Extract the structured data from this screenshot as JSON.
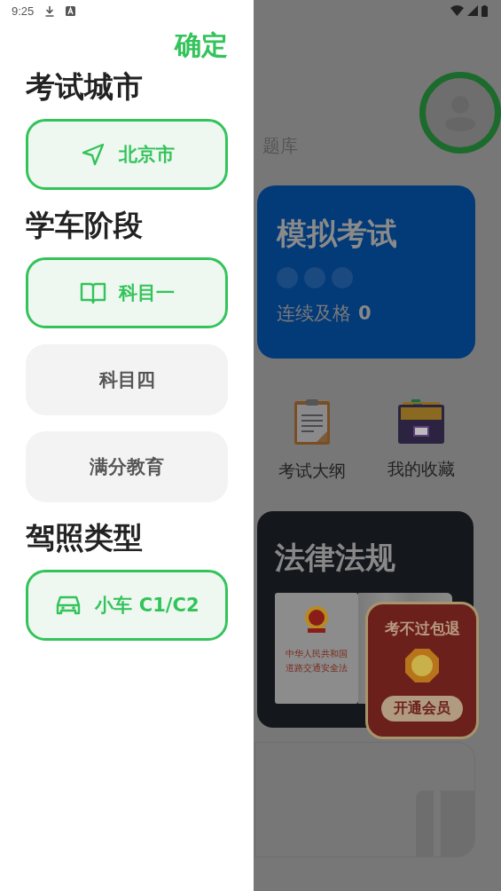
{
  "status_bar": {
    "time": "9:25"
  },
  "drawer": {
    "confirm": "确定",
    "sections": [
      {
        "title": "考试城市",
        "options": [
          {
            "label": "北京市",
            "selected": true
          }
        ]
      },
      {
        "title": "学车阶段",
        "options": [
          {
            "label": "科目一",
            "selected": true
          },
          {
            "label": "科目四",
            "selected": false
          },
          {
            "label": "满分教育",
            "selected": false
          }
        ]
      },
      {
        "title": "驾照类型",
        "options": [
          {
            "label": "小车 C1/C2",
            "selected": true
          }
        ]
      }
    ]
  },
  "background": {
    "bank_label": "题库",
    "mock_exam": {
      "title": "模拟考试",
      "streak_label": "连续及格",
      "streak_count": "0"
    },
    "shortcuts": [
      {
        "label": "考试大纲"
      },
      {
        "label": "我的收藏"
      }
    ],
    "law_card": {
      "title": "法律法规",
      "book_title": [
        "中华人民共和国",
        "道路交通安全法"
      ]
    },
    "promo": {
      "title": "考不过包退",
      "button": "开通会员"
    }
  }
}
